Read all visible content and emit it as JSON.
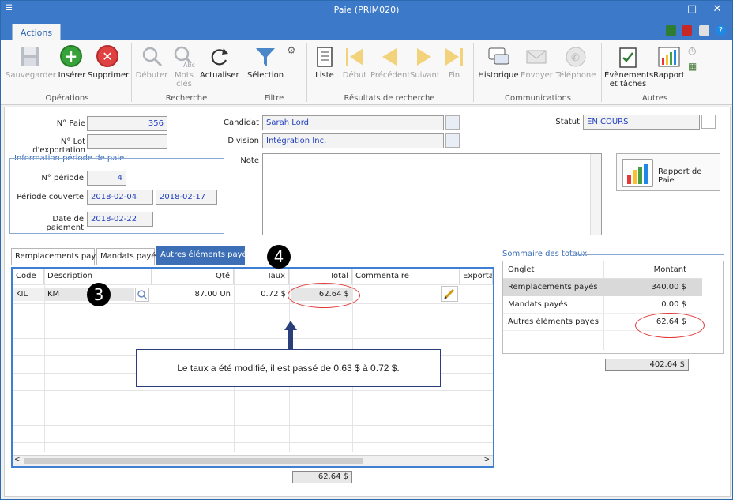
{
  "window": {
    "title": "Paie (PRIM020)"
  },
  "ribbon": {
    "tab": "Actions",
    "groups": {
      "operations": "Opérations",
      "recherche": "Recherche",
      "filtre": "Filtre",
      "resultats": "Résultats de recherche",
      "communications": "Communications",
      "autres": "Autres"
    },
    "buttons": {
      "save": "Sauvegarder",
      "insert": "Insérer",
      "delete": "Supprimer",
      "start": "Débuter",
      "keywords": "Mots\nclés",
      "refresh": "Actualiser",
      "selection": "Sélection",
      "list": "Liste",
      "first": "Début",
      "prev": "Précédent",
      "next": "Suivant",
      "last": "Fin",
      "history": "Historique",
      "send": "Envoyer",
      "phone": "Téléphone",
      "events": "Évènements\net tâches",
      "report": "Rapport"
    }
  },
  "form": {
    "pay_no_label": "N° Paie",
    "pay_no": "356",
    "lot_label": "N° Lot d'exportation",
    "lot": "",
    "candidate_label": "Candidat",
    "candidate": "Sarah Lord",
    "division_label": "Division",
    "division": "Intégration Inc.",
    "status_label": "Statut",
    "status": "EN COURS",
    "note_label": "Note",
    "period_legend": "Information période de paie",
    "period_no_label": "N° période",
    "period_no": "4",
    "period_range_label": "Période couverte",
    "period_from": "2018-02-04",
    "period_to": "2018-02-17",
    "pay_date_label": "Date de paiement",
    "pay_date": "2018-02-22",
    "report_button": "Rapport de Paie"
  },
  "tabs": [
    "Remplacements payés",
    "Mandats payés",
    "Autres éléments payés"
  ],
  "grid": {
    "headers": {
      "code": "Code",
      "description": "Description",
      "qty": "Qté",
      "rate": "Taux",
      "total": "Total",
      "comment": "Commentaire",
      "export": "Exportat"
    },
    "row": {
      "code": "KIL",
      "description": "KM",
      "qty": "87.00 Un",
      "rate": "0.72 $",
      "total": "62.64 $"
    },
    "footer_total": "62.64 $"
  },
  "summary": {
    "legend": "Sommaire des totaux",
    "col_tab": "Onglet",
    "col_amount": "Montant",
    "rows": [
      {
        "label": "Remplacements payés",
        "amount": "340.00 $"
      },
      {
        "label": "Mandats payés",
        "amount": "0.00 $"
      },
      {
        "label": "Autres éléments payés",
        "amount": "62.64 $"
      }
    ],
    "grand_total": "402.64 $"
  },
  "annotations": {
    "badge3": "3",
    "badge4": "4",
    "callout": "Le taux a été modifié, il est passé de 0.63 $ à 0.72 $."
  },
  "colors": {
    "accent": "#3c79c8",
    "field_text": "#1f3fbf",
    "highlight": "#e03a3a"
  }
}
